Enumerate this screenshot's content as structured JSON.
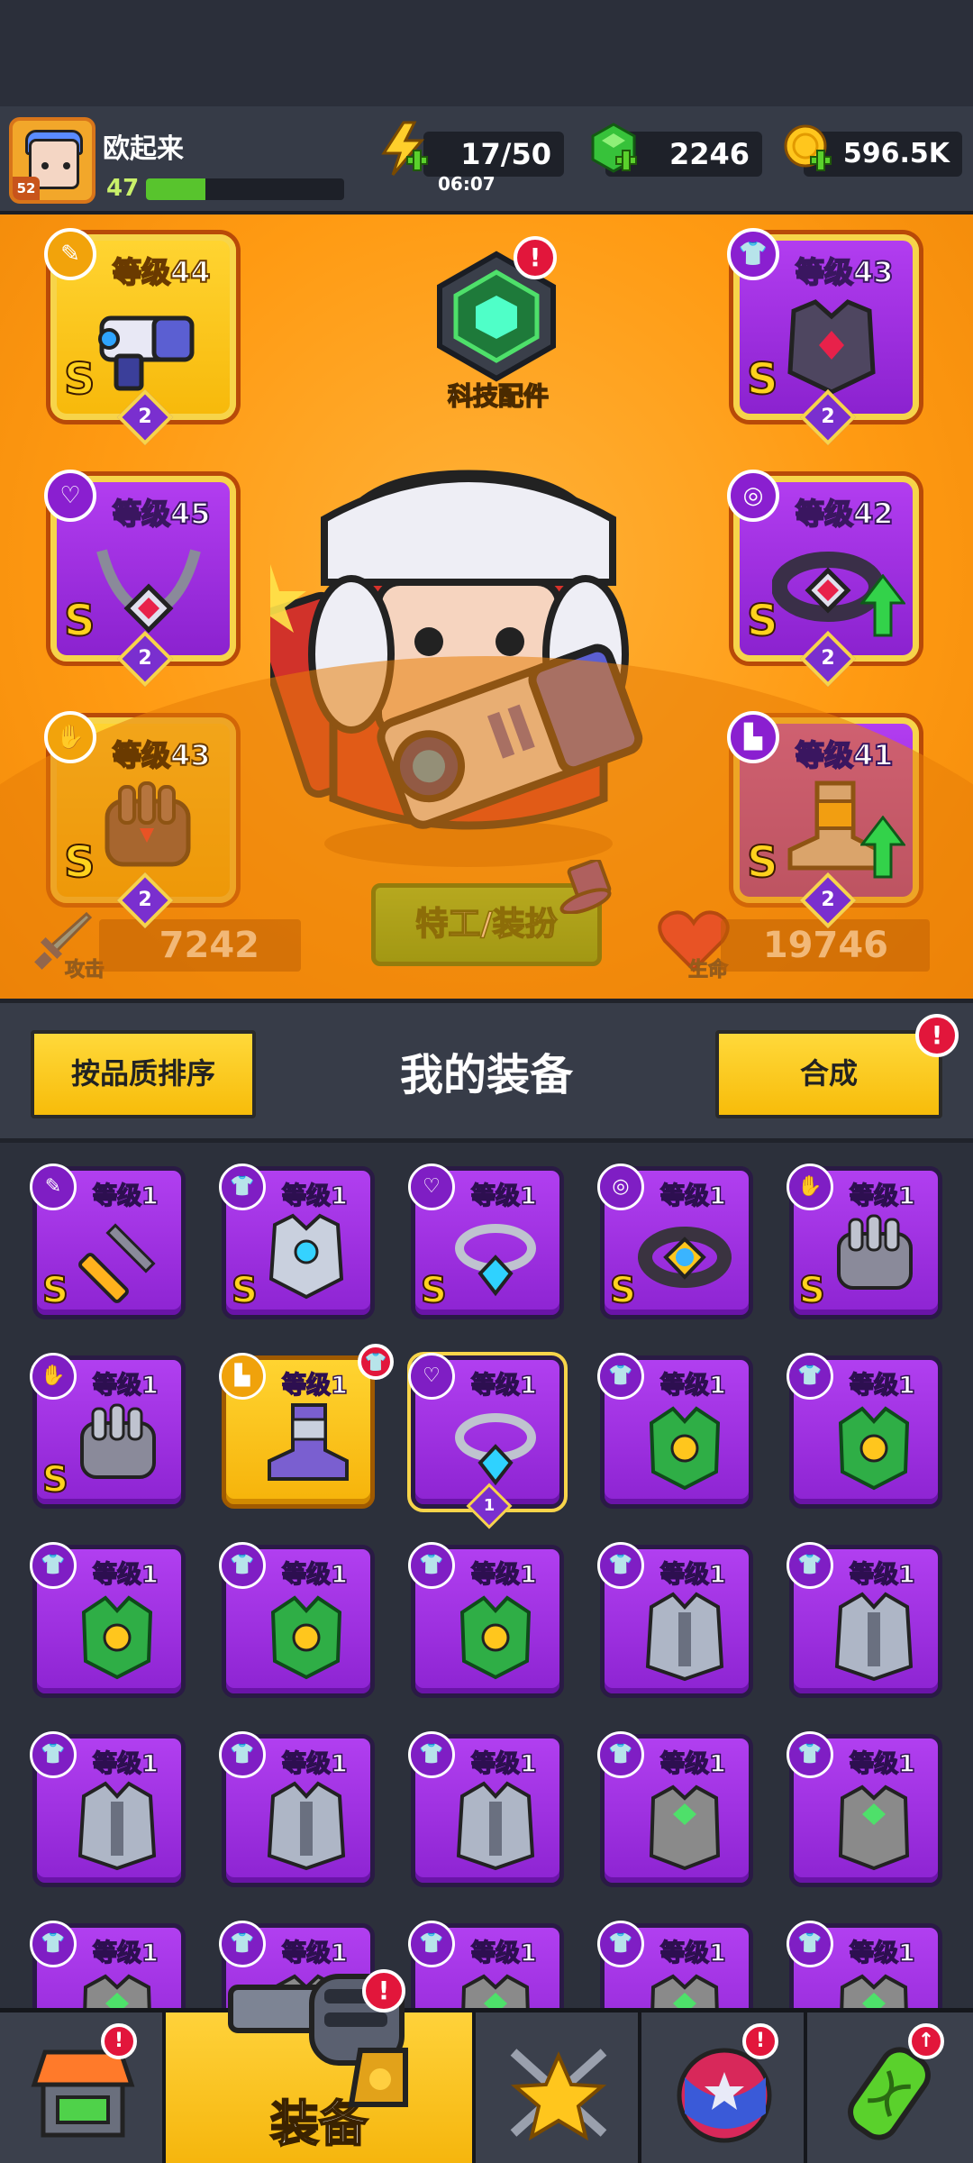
{
  "player": {
    "name": "欧起来",
    "avatar_level": "52",
    "level": "47",
    "xp_fraction": 0.3
  },
  "resources": {
    "energy": "17/50",
    "energy_timer": "06:07",
    "gems": "2246",
    "coins": "596.5K"
  },
  "tech": {
    "label": "科技配件",
    "alert": "!"
  },
  "slots": {
    "weapon": {
      "level": "等级44",
      "grade": "S",
      "stars": "2",
      "icon": "weapon-slot-icon"
    },
    "armor": {
      "level": "等级43",
      "grade": "S",
      "stars": "2",
      "icon": "armor-slot-icon"
    },
    "necklace": {
      "level": "等级45",
      "grade": "S",
      "stars": "2",
      "icon": "necklace-slot-icon"
    },
    "belt": {
      "level": "等级42",
      "grade": "S",
      "stars": "2",
      "icon": "belt-slot-icon"
    },
    "gloves": {
      "level": "等级43",
      "grade": "S",
      "stars": "2",
      "icon": "gloves-slot-icon"
    },
    "boots": {
      "level": "等级41",
      "grade": "S",
      "stars": "2",
      "icon": "boots-slot-icon"
    }
  },
  "stats": {
    "attack_label": "攻击",
    "attack_value": "7242",
    "hp_label": "生命",
    "hp_value": "19746"
  },
  "costume_button": "特工/装扮",
  "equipment_header": {
    "sort_button": "按品质排序",
    "title": "我的装备",
    "merge_button": "合成",
    "merge_alert": "!"
  },
  "inventory": [
    {
      "level": "等级1",
      "grade": "S",
      "type": "weapon",
      "color": "purple"
    },
    {
      "level": "等级1",
      "grade": "S",
      "type": "armor",
      "color": "purple"
    },
    {
      "level": "等级1",
      "grade": "S",
      "type": "necklace",
      "color": "purple"
    },
    {
      "level": "等级1",
      "grade": "S",
      "type": "belt",
      "color": "purple"
    },
    {
      "level": "等级1",
      "grade": "S",
      "type": "gloves",
      "color": "purple"
    },
    {
      "level": "等级1",
      "grade": "S",
      "type": "gloves",
      "color": "purple"
    },
    {
      "level": "等级1",
      "grade": "",
      "type": "boots",
      "color": "gold"
    },
    {
      "level": "等级1",
      "grade": "",
      "type": "necklace",
      "color": "purple",
      "stars": "1"
    },
    {
      "level": "等级1",
      "grade": "",
      "type": "armor",
      "color": "purple"
    },
    {
      "level": "等级1",
      "grade": "",
      "type": "armor",
      "color": "purple"
    },
    {
      "level": "等级1",
      "grade": "",
      "type": "armor",
      "color": "purple"
    },
    {
      "level": "等级1",
      "grade": "",
      "type": "armor",
      "color": "purple"
    },
    {
      "level": "等级1",
      "grade": "",
      "type": "armor",
      "color": "purple"
    },
    {
      "level": "等级1",
      "grade": "",
      "type": "armor",
      "color": "purple"
    },
    {
      "level": "等级1",
      "grade": "",
      "type": "armor",
      "color": "purple"
    },
    {
      "level": "等级1",
      "grade": "",
      "type": "armor",
      "color": "purple"
    },
    {
      "level": "等级1",
      "grade": "",
      "type": "armor",
      "color": "purple"
    },
    {
      "level": "等级1",
      "grade": "",
      "type": "armor",
      "color": "purple"
    },
    {
      "level": "等级1",
      "grade": "",
      "type": "armor",
      "color": "purple"
    },
    {
      "level": "等级1",
      "grade": "",
      "type": "armor",
      "color": "purple"
    },
    {
      "level": "等级1",
      "grade": "",
      "type": "armor",
      "color": "purple"
    },
    {
      "level": "等级1",
      "grade": "",
      "type": "armor",
      "color": "purple"
    },
    {
      "level": "等级1",
      "grade": "",
      "type": "armor",
      "color": "purple"
    },
    {
      "level": "等级1",
      "grade": "",
      "type": "armor",
      "color": "purple"
    },
    {
      "level": "等级1",
      "grade": "",
      "type": "armor",
      "color": "purple"
    }
  ],
  "nav": {
    "shop_alert": "!",
    "equipment_label": "装备",
    "equipment_alert": "!",
    "events_alert": "!",
    "upgrade_alert": "↑"
  },
  "colors": {
    "hero_bg": "#ff9a12",
    "purple": "#9b2de0",
    "gold": "#ffcc22",
    "alert_red": "#e2163b",
    "green": "#58c42d"
  }
}
